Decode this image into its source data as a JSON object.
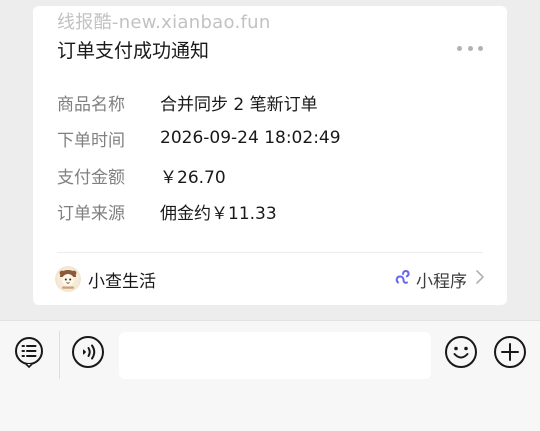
{
  "watermark": "线报酷-new.xianbao.fun",
  "card": {
    "title": "订单支付成功通知",
    "rows": [
      {
        "label": "商品名称",
        "value": "合并同步 2 笔新订单"
      },
      {
        "label": "下单时间",
        "value": "2026-09-24 18:02:49"
      },
      {
        "label": "支付金额",
        "value": "￥26.70"
      },
      {
        "label": "订单来源",
        "value": "佣金约￥11.33"
      }
    ],
    "footer": {
      "app_name": "小查生活",
      "app_icon": "mascot-avatar",
      "mini_program_label": "小程序",
      "mini_program_icon": "mini-program-link-icon"
    }
  },
  "input_bar": {
    "left_icons": [
      "list-menu-icon",
      "voice-icon"
    ],
    "right_icons": [
      "emoji-icon",
      "plus-icon"
    ],
    "input_value": ""
  }
}
